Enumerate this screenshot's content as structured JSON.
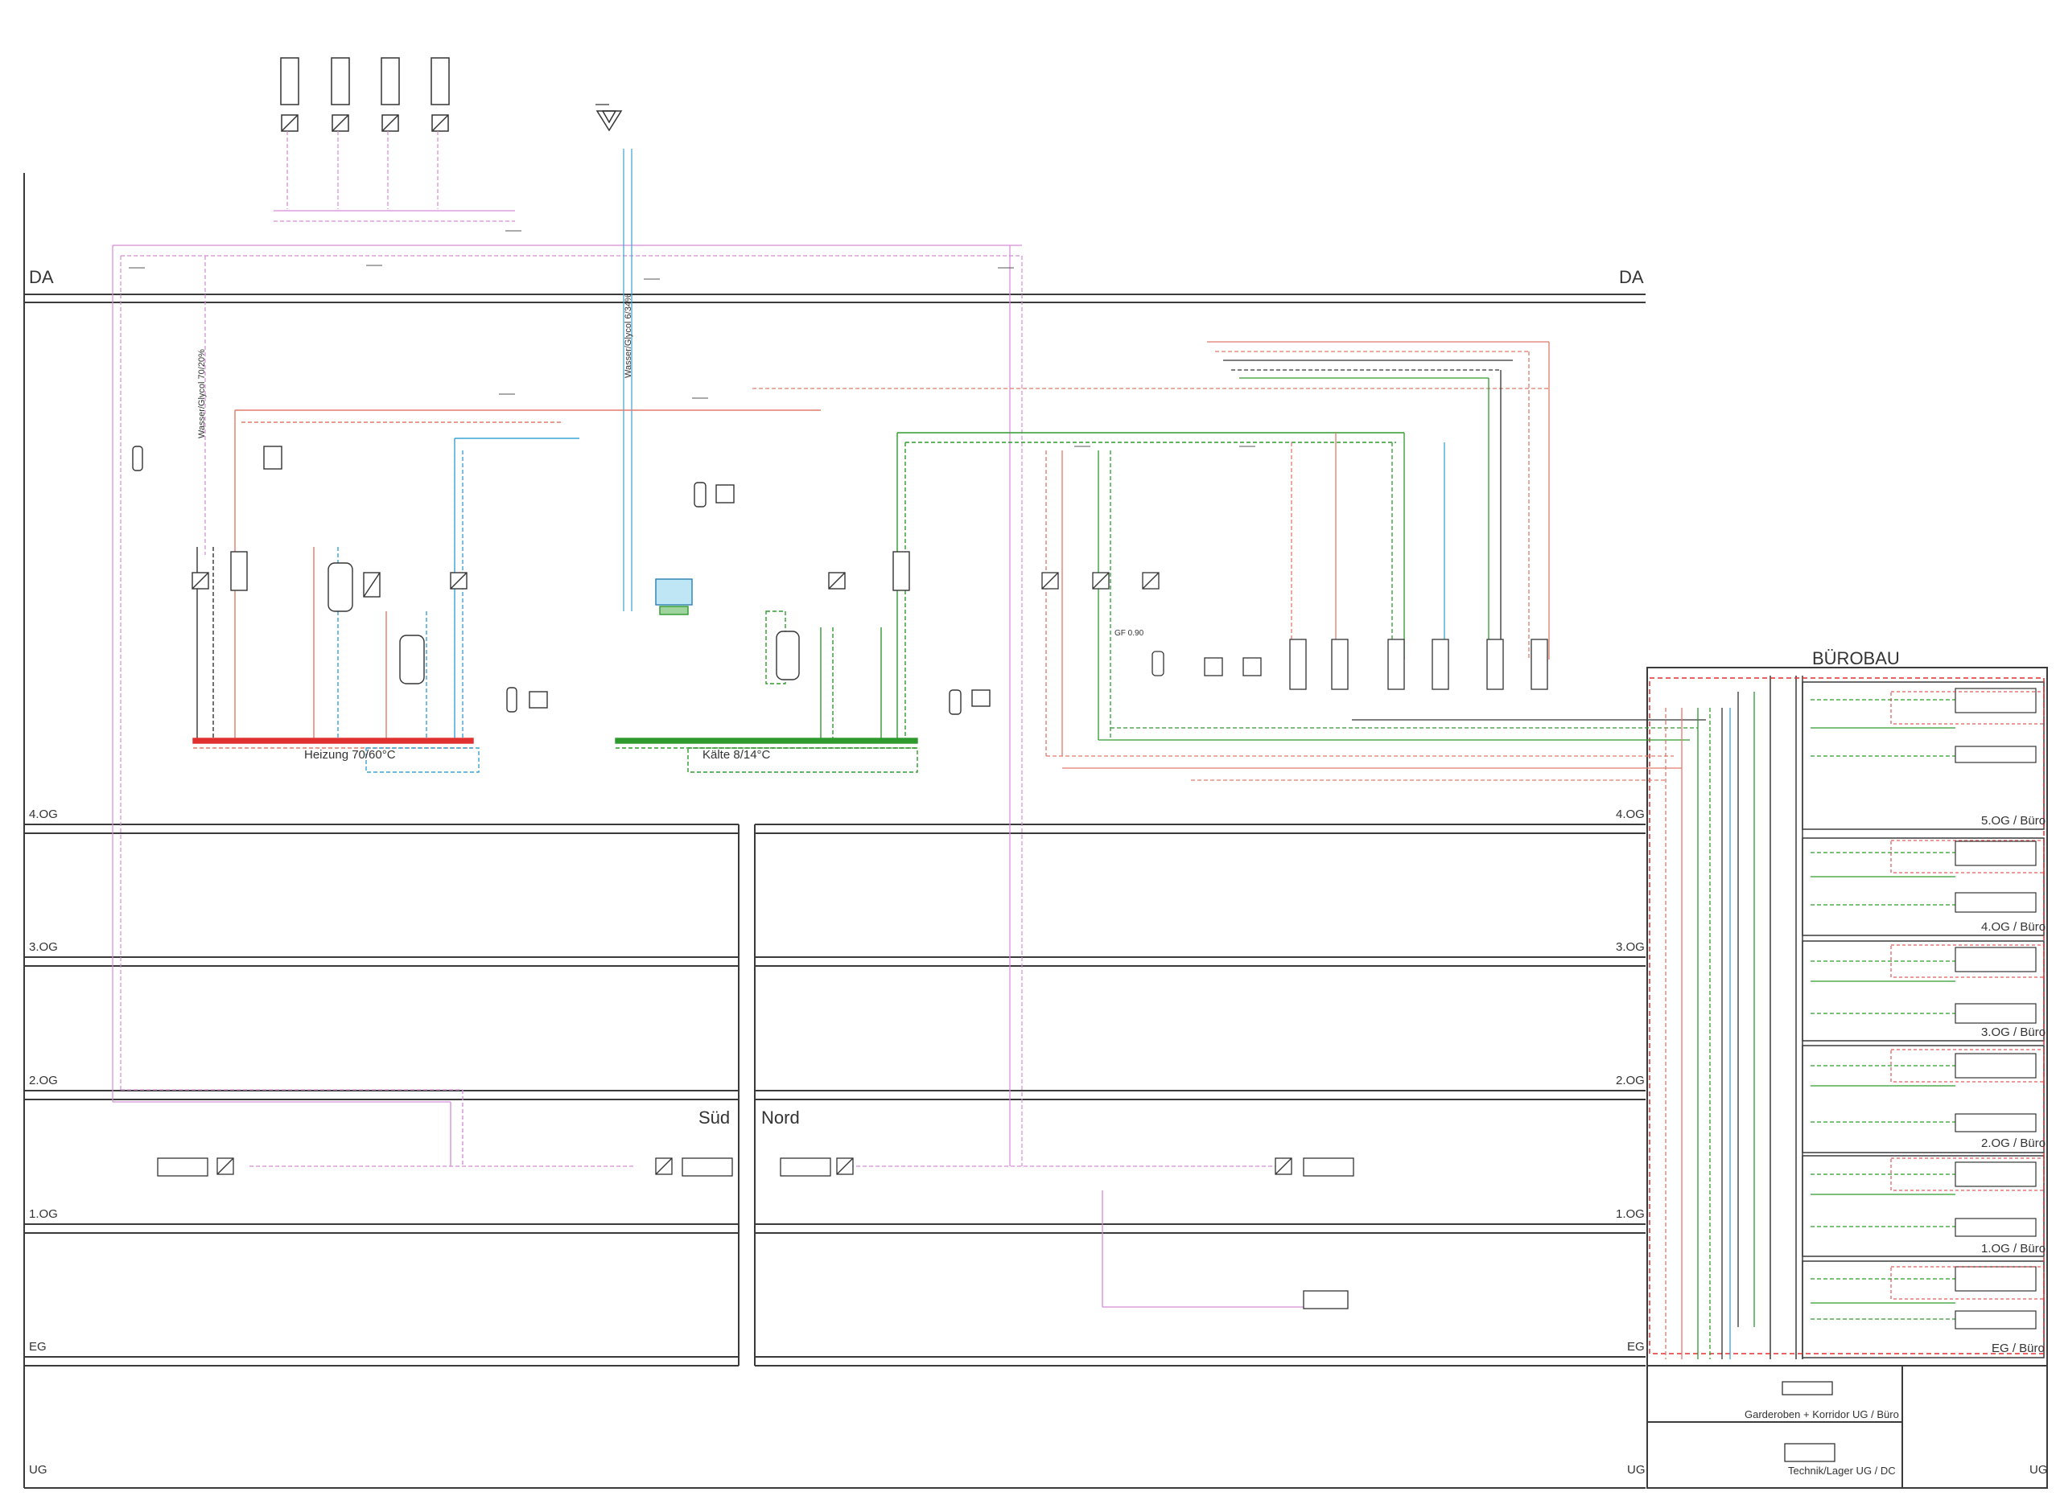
{
  "floors": {
    "da": "DA",
    "og4": "4.OG",
    "og3": "3.OG",
    "og2": "2.OG",
    "og1": "1.OG",
    "eg": "EG",
    "ug": "UG"
  },
  "buildings": {
    "sued": "Süd",
    "nord": "Nord",
    "buerobau": "BÜROBAU"
  },
  "circuits": {
    "heizung": "Heizung 70/60°C",
    "kaelte": "Kälte 8/14°C",
    "glycol_heat": "Wasser/Glycol 70/20%",
    "glycol_cool": "Wasser/Glycol 6/34%",
    "gf": "GF 0.90"
  },
  "buero_sections": [
    "5.OG / Büro",
    "4.OG / Büro",
    "3.OG / Büro",
    "2.OG / Büro",
    "1.OG / Büro",
    "EG / Büro"
  ],
  "ug_sections": {
    "garderoben": "Garderoben + Korridor UG / Büro",
    "technik": "Technik/Lager UG / DC"
  },
  "colors": {
    "heating": "#e07a6a",
    "cooling": "#3aa3d6",
    "chilled": "#2e9a2e",
    "glycol": "#d58ad8",
    "frame": "#3a3a3a",
    "return_red": "#e03030"
  }
}
